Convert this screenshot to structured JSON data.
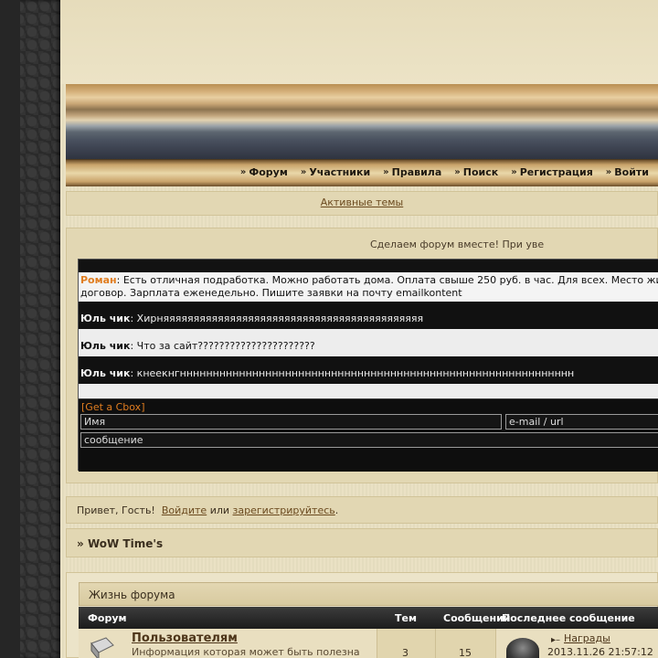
{
  "nav": {
    "items": [
      {
        "label": "Форум"
      },
      {
        "label": "Участники"
      },
      {
        "label": "Правила"
      },
      {
        "label": "Поиск"
      },
      {
        "label": "Регистрация"
      },
      {
        "label": "Войти"
      }
    ]
  },
  "active_topics": {
    "label": "Активные темы"
  },
  "cbox": {
    "title": "Сделаем форум вместе! При уве",
    "messages": [
      {
        "name": "Роман",
        "line1": ": Есть отличная подработка. Можно работать дома. Оплата свыше 250 руб. в час. Для всех. Место жи",
        "line2": "договор. Зарплата еженедельно. Пишите заявки на почту emailkontent"
      },
      {
        "name": "Юль чик",
        "text": ": Хирняяяяяяяяяяяяяяяяяяяяяяяяяяяяяяяяяяяяяяяяяяя"
      },
      {
        "name": "Юль чик",
        "text": ": Что за сайт??????????????????????"
      },
      {
        "name": "Юль чик",
        "text": ": кнеекнгнннннннннннннннннннннннннннннннннннннннннннннннннннннннннннн"
      }
    ],
    "get_cbox": "[Get a Cbox]",
    "name_placeholder": "Имя",
    "url_placeholder": "e-mail / url",
    "message_placeholder": "сообщение"
  },
  "welcome": {
    "greeting": "Привет, Гость!",
    "login": "Войдите",
    "or": "или",
    "register": "зарегистрируйтесь",
    "period": "."
  },
  "breadcrumb": {
    "prefix": "»",
    "title": "WoW Time's"
  },
  "forum": {
    "category": "Жизнь форума",
    "columns": {
      "forum": "Форум",
      "topics": "Тем",
      "posts": "Сообщений",
      "last": "Последнее сообщение"
    },
    "rows": [
      {
        "title": "Пользователям",
        "description": "Информация которая может быть полезна",
        "topics": "3",
        "posts": "15",
        "last_post_title": "Награды",
        "last_post_date": "2013.11.26 21:57:12"
      }
    ]
  },
  "colors": {
    "accent_orange": "#e07d20",
    "link_brown": "#6b4a1f",
    "cbox_bg": "#121212"
  }
}
